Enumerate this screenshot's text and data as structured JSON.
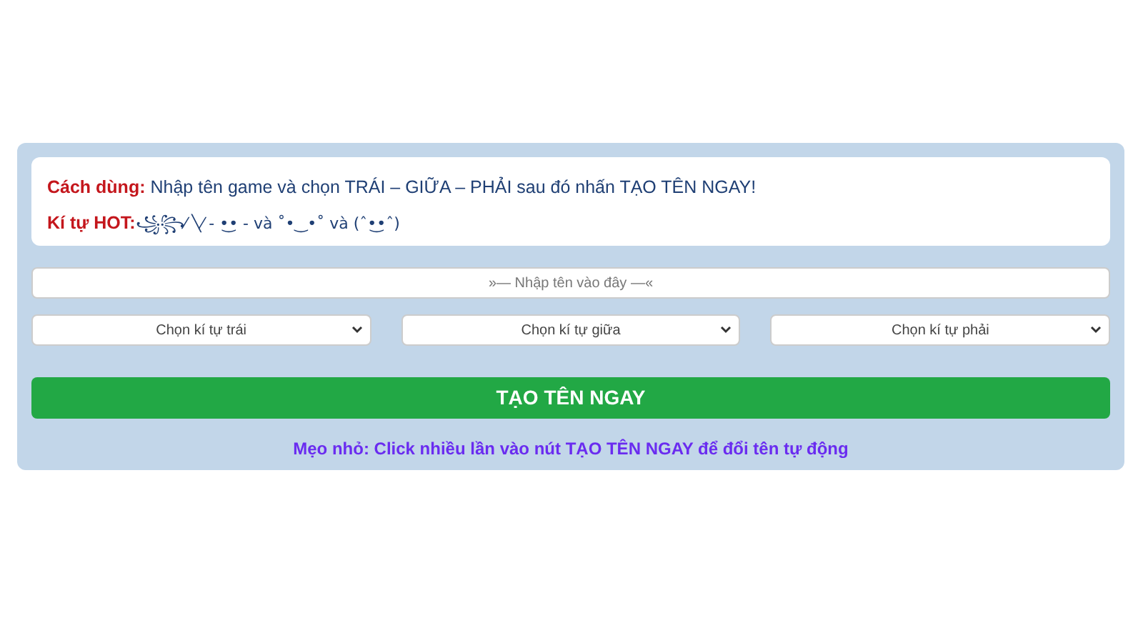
{
  "instructions": {
    "usage_label": "Cách dùng:",
    "usage_text": "Nhập tên game và chọn TRÁI – GIỮA – PHẢI sau đó nhấn TẠO TÊN NGAY!",
    "hot_label": "Kí tự HOT:",
    "hot_text": "꧁꧂⁄ ╲⁄ - •͜• - và ˚•‿•˚ và (ˆ•͜•ˆ)"
  },
  "name_input": {
    "placeholder": "»— Nhập tên vào đây —«"
  },
  "selects": [
    {
      "placeholder": "Chọn kí tự trái"
    },
    {
      "placeholder": "Chọn kí tự giữa"
    },
    {
      "placeholder": "Chọn kí tự phải"
    }
  ],
  "generate_button": "TẠO TÊN NGAY",
  "tip": "Mẹo nhỏ: Click nhiều lần vào nút TẠO TÊN NGAY để đổi tên tự động"
}
